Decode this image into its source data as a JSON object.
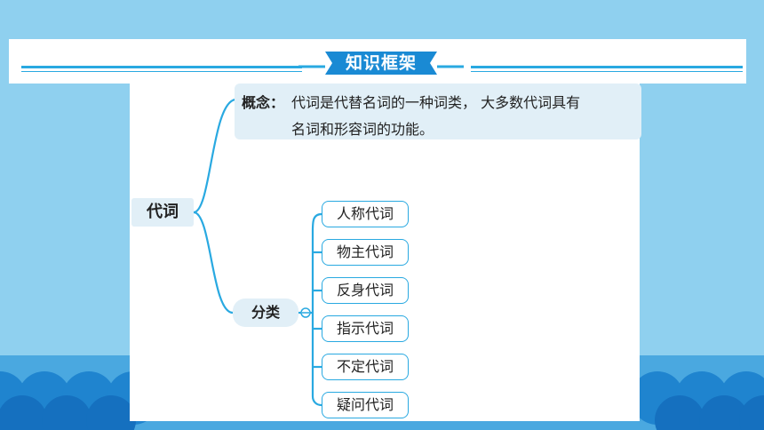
{
  "header": {
    "title": "知识框架"
  },
  "diagram": {
    "root": "代词",
    "concept": {
      "label": "概念：",
      "line1": "代词是代替名词的一种词类， 大多数代词具有",
      "line2": "名词和形容词的功能。"
    },
    "category": {
      "label": "分类",
      "items": [
        "人称代词",
        "物主代词",
        "反身代词",
        "指示代词",
        "不定代词",
        "疑问代词"
      ]
    }
  },
  "colors": {
    "accent": "#29a9e1",
    "node_fill": "#e1eff7",
    "background": "#8fd0ef",
    "wave": "#4aa8e0"
  }
}
